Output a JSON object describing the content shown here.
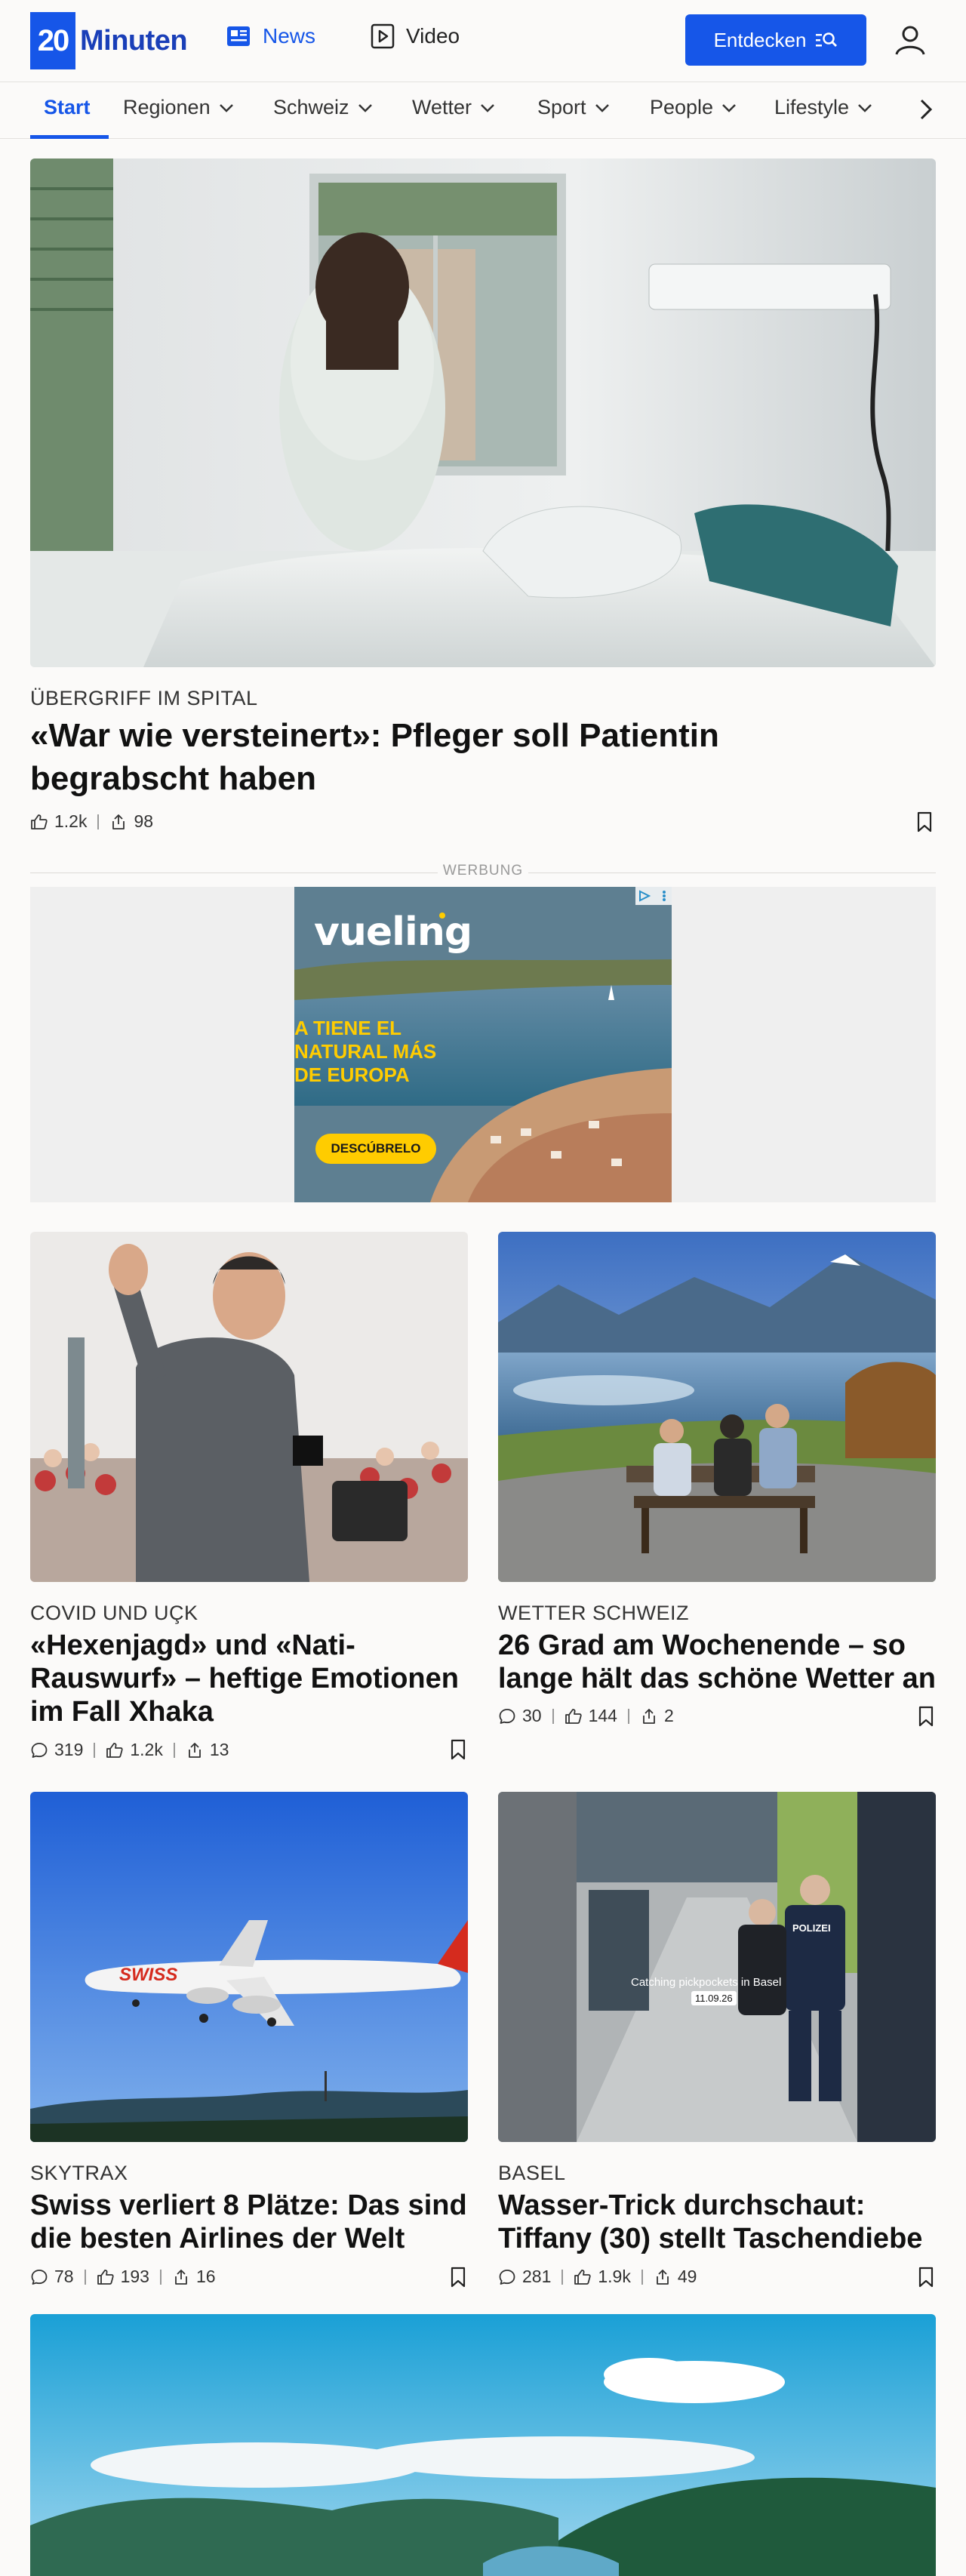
{
  "header": {
    "logo_number": "20",
    "logo_text": "Minuten",
    "nav_news": "News",
    "nav_video": "Video",
    "discover_label": "Entdecken"
  },
  "categories": [
    {
      "label": "Start",
      "active": true
    },
    {
      "label": "Regionen"
    },
    {
      "label": "Schweiz"
    },
    {
      "label": "Wetter"
    },
    {
      "label": "Sport"
    },
    {
      "label": "People"
    },
    {
      "label": "Lifestyle"
    }
  ],
  "hero": {
    "kicker": "ÜBERGRIFF IM SPITAL",
    "title_line1": "«War wie versteinert»: Pfleger soll Patientin",
    "title_line2": "begrabscht haben",
    "likes": "1.2k",
    "shares": "98"
  },
  "ad": {
    "label": "WERBUNG",
    "brand": "vueling",
    "text_line1": "A TIENE EL",
    "text_line2": "NATURAL MÁS",
    "text_line3": "DE EUROPA",
    "cta": "DESCÚBRELO"
  },
  "articles": [
    {
      "kicker": "COVID UND UÇK",
      "title_line1": "«Hexenjagd» und «Nati-",
      "title_line2": "Rauswurf» – heftige Emotionen",
      "title_line3": "im Fall Xhaka",
      "comments": "319",
      "likes": "1.2k",
      "shares": "13"
    },
    {
      "kicker": "WETTER SCHWEIZ",
      "title_line1": "26 Grad am Wochenende – so",
      "title_line2": "lange hält das schöne Wetter an",
      "comments": "30",
      "likes": "144",
      "shares": "2"
    },
    {
      "kicker": "SKYTRAX",
      "title_line1": "Swiss verliert 8 Plätze: Das sind",
      "title_line2": "die besten Airlines der Welt",
      "comments": "78",
      "likes": "193",
      "shares": "16",
      "image_text": "SWISS"
    },
    {
      "kicker": "BASEL",
      "title_line1": "Wasser-Trick durchschaut:",
      "title_line2": "Tiffany (30) stellt Taschendiebe",
      "comments": "281",
      "likes": "1.9k",
      "shares": "49",
      "overlay_caption": "Catching pickpockets in Basel",
      "overlay_date": "11.09.26",
      "police_label": "POLIZEI"
    }
  ],
  "colors": {
    "accent": "#1656e8",
    "background": "#fbfaf9"
  }
}
